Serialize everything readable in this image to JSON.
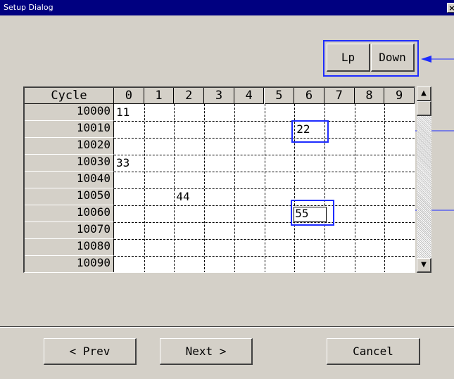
{
  "window": {
    "title": "Setup Dialog",
    "close_glyph": "×"
  },
  "updown": {
    "up_label": "Lp",
    "down_label": "Down"
  },
  "grid": {
    "corner_label": "Cycle",
    "columns": [
      "0",
      "1",
      "2",
      "3",
      "4",
      "5",
      "6",
      "7",
      "8",
      "9"
    ],
    "rows": [
      "10000",
      "10010",
      "10020",
      "10030",
      "10040",
      "10050",
      "10060",
      "10070",
      "10080",
      "10090"
    ],
    "values": [
      {
        "row": 0,
        "col": 0,
        "text": "11"
      },
      {
        "row": 1,
        "col": 6,
        "text": "22"
      },
      {
        "row": 3,
        "col": 0,
        "text": "33"
      },
      {
        "row": 5,
        "col": 2,
        "text": "44"
      }
    ],
    "editing": {
      "row": 6,
      "col": 6,
      "text": "55"
    }
  },
  "scrollbar": {
    "up_glyph": "▲",
    "down_glyph": "▼"
  },
  "footer": {
    "prev_label": "< Prev",
    "next_label": "Next >",
    "cancel_label": "Cancel"
  },
  "colors": {
    "annotation": "#1e2cff",
    "titlebar": "#000080",
    "face": "#d4d0c8"
  }
}
